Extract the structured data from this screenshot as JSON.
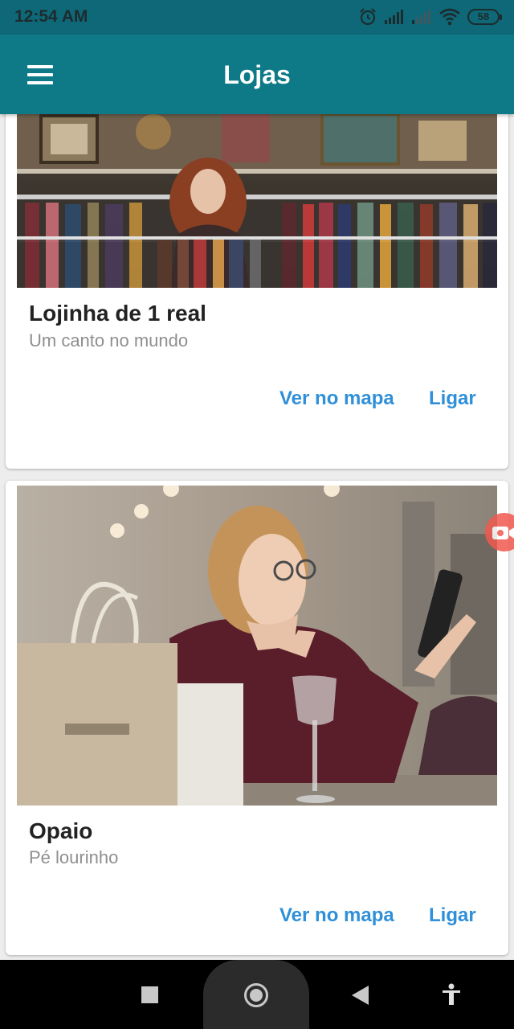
{
  "status_bar": {
    "time": "12:54 AM",
    "battery": "58",
    "icons": [
      "alarm-icon",
      "signal-icon",
      "signal-weak-icon",
      "wifi-icon",
      "battery-icon"
    ]
  },
  "app_bar": {
    "title": "Lojas",
    "menu_icon": "hamburger-menu-icon",
    "color": "#0e7a88"
  },
  "stores": [
    {
      "name": "Lojinha de 1 real",
      "description": "Um canto no mundo",
      "image": "clothing-store-photo",
      "actions": {
        "map": "Ver no mapa",
        "call": "Ligar"
      }
    },
    {
      "name": "Opaio",
      "description": "Pé lourinho",
      "image": "woman-with-phone-photo",
      "actions": {
        "map": "Ver no mapa",
        "call": "Ligar"
      }
    }
  ],
  "accent_color": "#2f8fd8",
  "floating_button": {
    "icon": "video-record-icon"
  },
  "nav_bar": {
    "icons": [
      "recent-apps-icon",
      "home-icon",
      "back-icon",
      "accessibility-icon"
    ]
  }
}
